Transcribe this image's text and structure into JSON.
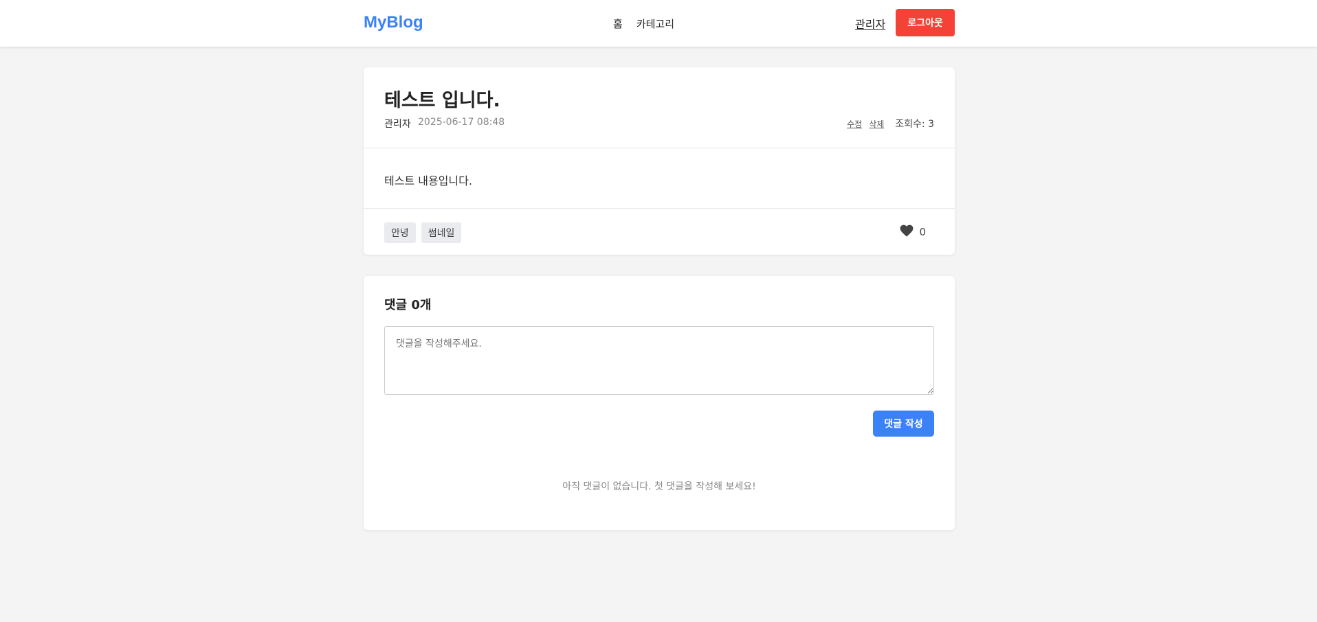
{
  "header": {
    "logo": "MyBlog",
    "nav": [
      "홈",
      "카테고리"
    ],
    "user_name": "관리자",
    "logout_label": "로그아웃"
  },
  "post": {
    "title": "테스트 입니다.",
    "author": "관리자",
    "date": "2025-06-17 08:48",
    "edit_label": "수정",
    "delete_label": "삭제",
    "views": "조회수: 3",
    "content": "테스트 내용입니다.",
    "tags": [
      "안녕",
      "썸네일"
    ],
    "likes": "0"
  },
  "comments": {
    "heading": "댓글 0개",
    "placeholder": "댓글을 작성해주세요.",
    "submit_label": "댓글 작성",
    "empty_message": "아직 댓글이 없습니다. 첫 댓글을 작성해 보세요!"
  },
  "colors": {
    "brand": "#3b82f6",
    "danger": "#f44336",
    "background": "#f4f4f4"
  },
  "icons": {
    "like": "heart-icon"
  }
}
